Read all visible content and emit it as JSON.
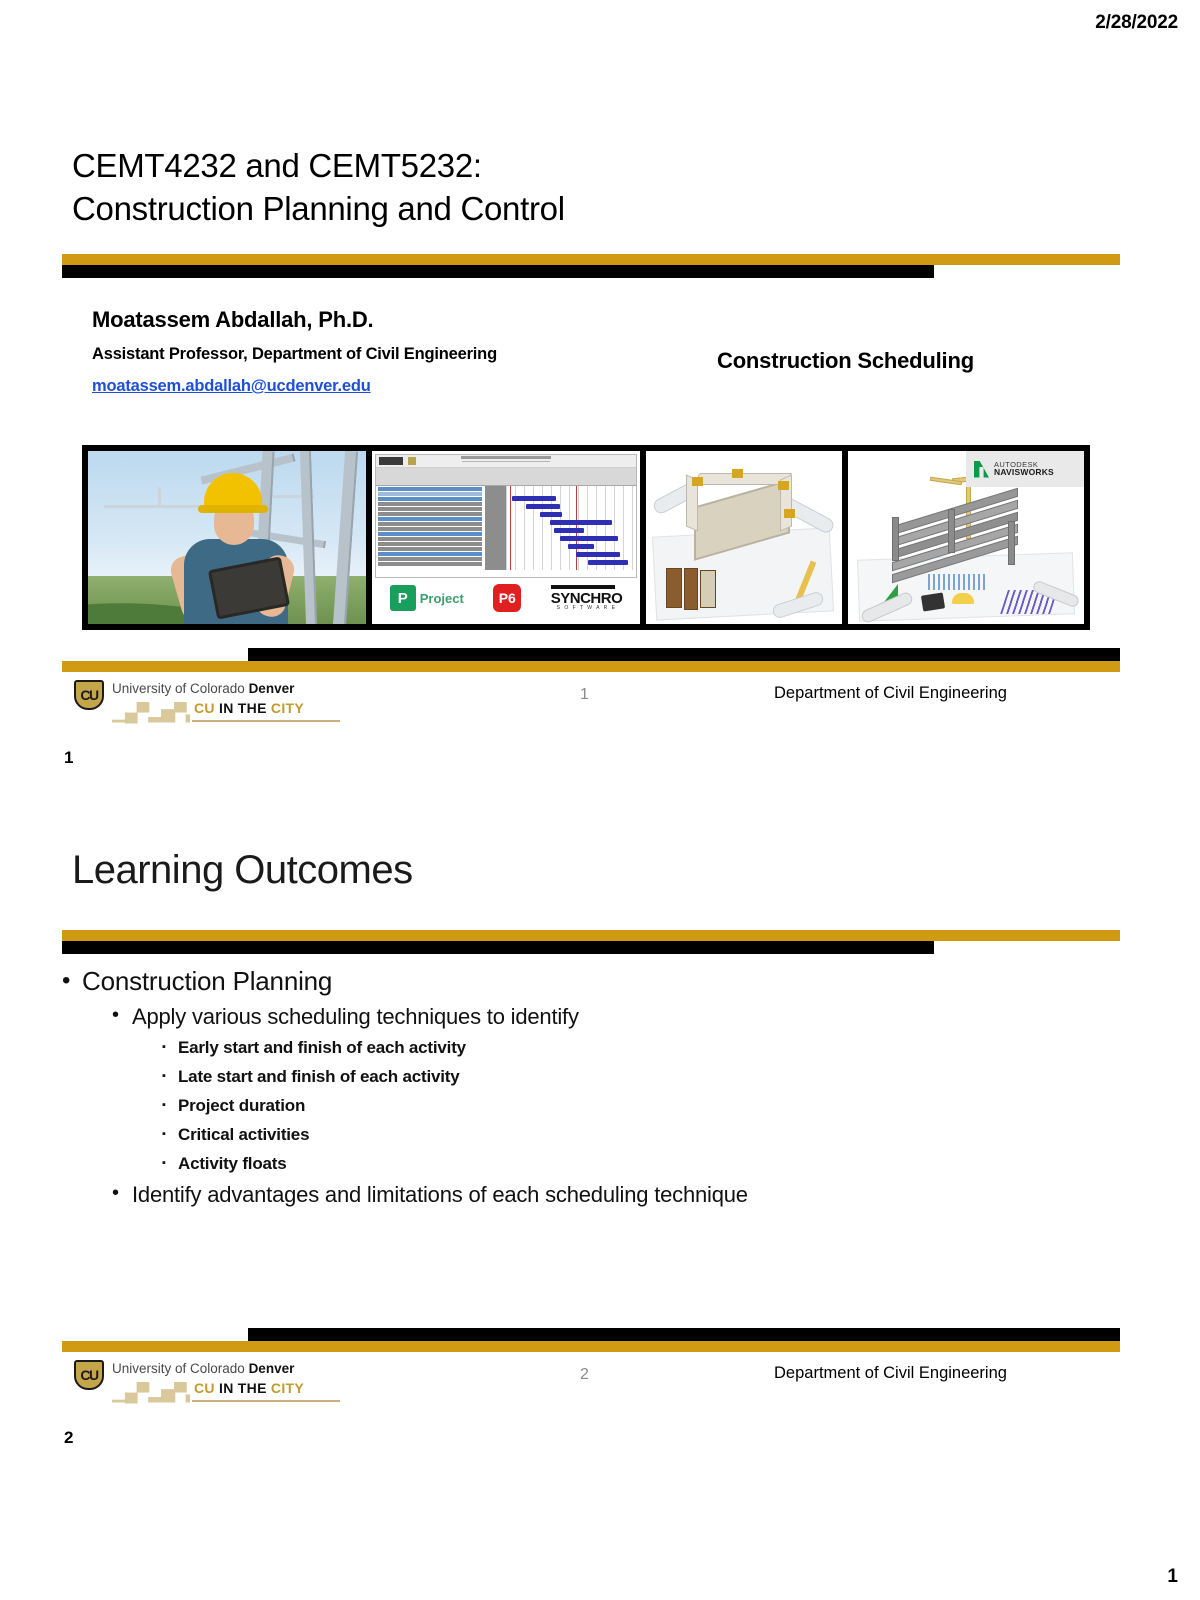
{
  "document": {
    "date": "2/28/2022",
    "corner_page_number": "1"
  },
  "slides": [
    {
      "outside_number": "1",
      "title_lines": [
        "CEMT4232 and CEMT5232:",
        "Construction Planning and Control"
      ],
      "presenter": {
        "name": "Moatassem Abdallah, Ph.D.",
        "role": "Assistant Professor, Department of Civil Engineering",
        "email": "moatassem.abdallah@ucdenver.edu"
      },
      "topic": "Construction Scheduling",
      "image_strip": [
        {
          "name": "construction-worker-with-tablet-photo"
        },
        {
          "name": "gantt-chart-screenshot",
          "logos": [
            {
              "mark": "P",
              "label": "Project"
            },
            {
              "mark": "P6",
              "label": "P6"
            },
            {
              "title": "SYNCHRO",
              "subtitle": "S O F T W A R E"
            }
          ]
        },
        {
          "name": "building-model-with-blueprints-render"
        },
        {
          "name": "autodesk-navisworks-render",
          "badge_line1": "AUTODESK",
          "badge_line2": "NAVISWORKS"
        }
      ],
      "footer": {
        "logo_line1_light": "University of Colorado ",
        "logo_line1_bold": "Denver",
        "logo_line2_gold_cu": "CU ",
        "logo_line2_black": "IN THE ",
        "logo_line2_gold_city": "CITY",
        "slide_number": "1",
        "department": "Department of Civil Engineering"
      }
    },
    {
      "outside_number": "2",
      "title": "Learning Outcomes",
      "bullets": [
        {
          "level": 1,
          "text": "Construction Planning"
        },
        {
          "level": 2,
          "text": "Apply various scheduling techniques to identify"
        },
        {
          "level": 3,
          "text": "Early start and finish of each activity"
        },
        {
          "level": 3,
          "text": "Late start and finish of each activity"
        },
        {
          "level": 3,
          "text": "Project duration"
        },
        {
          "level": 3,
          "text": "Critical activities"
        },
        {
          "level": 3,
          "text": "Activity floats"
        },
        {
          "level": 2,
          "text": "Identify advantages and limitations of each scheduling technique"
        }
      ],
      "footer": {
        "logo_line1_light": "University of Colorado ",
        "logo_line1_bold": "Denver",
        "logo_line2_gold_cu": "CU ",
        "logo_line2_black": "IN THE ",
        "logo_line2_gold_city": "CITY",
        "slide_number": "2",
        "department": "Department of Civil Engineering"
      }
    }
  ],
  "colors": {
    "gold": "#d09a12",
    "black": "#000000",
    "link_blue": "#1f4fd8",
    "cu_gold": "#c49a2a"
  }
}
